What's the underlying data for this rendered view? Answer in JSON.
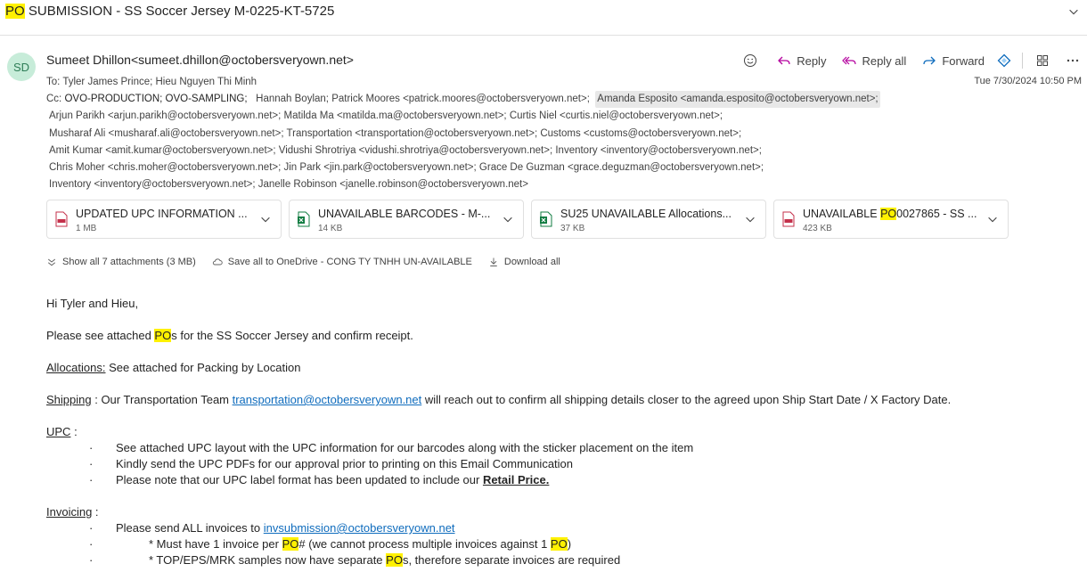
{
  "subject": {
    "hl": "PO",
    "rest": " SUBMISSION - SS Soccer Jersey M-0225-KT-5725"
  },
  "sender": {
    "initials": "SD",
    "name": "Sumeet Dhillon",
    "email": "<sumeet.dhillon@octobersveryown.net>"
  },
  "actions": {
    "reply": "Reply",
    "reply_all": "Reply all",
    "forward": "Forward"
  },
  "date": "Tue 7/30/2024 10:50 PM",
  "to_line": "To:  Tyler James Prince;   Hieu Nguyen Thi Minh",
  "cc": {
    "label": "Cc:",
    "first": "OVO-PRODUCTION;  OVO-SAMPLING;",
    "rest": "Hannah Boylan;   Patrick Moores <patrick.moores@octobersveryown.net>;",
    "chip": "Amanda Esposito <amanda.esposito@octobersveryown.net>;",
    "lines": [
      "Arjun Parikh <arjun.parikh@octobersveryown.net>;   Matilda Ma <matilda.ma@octobersveryown.net>;   Curtis Niel <curtis.niel@octobersveryown.net>;",
      "Musharaf Ali <musharaf.ali@octobersveryown.net>;   Transportation <transportation@octobersveryown.net>;   Customs <customs@octobersveryown.net>;",
      "Amit Kumar <amit.kumar@octobersveryown.net>;   Vidushi Shrotriya <vidushi.shrotriya@octobersveryown.net>;   Inventory <inventory@octobersveryown.net>;",
      "Chris Moher <chris.moher@octobersveryown.net>;   Jin Park <jin.park@octobersveryown.net>;   Grace De Guzman <grace.deguzman@octobersveryown.net>;",
      "Inventory <inventory@octobersveryown.net>;   Janelle Robinson <janelle.robinson@octobersveryown.net>"
    ]
  },
  "attachments": [
    {
      "name": "UPDATED UPC INFORMATION ...",
      "size": "1 MB",
      "type": "pdf"
    },
    {
      "name": "UNAVAILABLE BARCODES - M-...",
      "size": "14 KB",
      "type": "excel"
    },
    {
      "name": "SU25 UNAVAILABLE Allocations...",
      "size": "37 KB",
      "type": "excel"
    },
    {
      "name_pre": "UNAVAILABLE ",
      "name_hl": "PO",
      "name_post": "0027865 - SS ...",
      "size": "423 KB",
      "type": "pdf"
    }
  ],
  "att_tools": {
    "show_all": "Show all 7 attachments (3 MB)",
    "save_onedrive": "Save all to OneDrive - CONG TY TNHH UN-AVAILABLE",
    "download_all": "Download all"
  },
  "body": {
    "greeting": "Hi Tyler and Hieu,",
    "p1_pre": "Please see attached ",
    "p1_hl": "PO",
    "p1_post": "s for the SS Soccer Jersey and confirm receipt.",
    "alloc_label": "Allocations:",
    "alloc_text": " See attached for Packing by Location",
    "ship_label": "Shipping",
    "ship_pre": " : Our Transportation Team ",
    "ship_link": "transportation@octobersveryown.net",
    "ship_post": " will reach out to confirm all shipping details closer to the agreed upon Ship Start Date / X Factory Date.",
    "upc_label": "UPC",
    "upc_colon": " :",
    "bullet_char": "·",
    "upc_items": [
      "See attached UPC layout with the UPC information for our barcodes along with the sticker placement on the item",
      "Kindly send the UPC PDFs for our approval prior to printing on this Email Communication"
    ],
    "upc_item3_pre": "Please note that our UPC label format has been updated to include our ",
    "upc_item3_strong": "Retail Price.",
    "inv_label": "Invoicing",
    "inv_colon": " :",
    "inv_item1_pre": "Please send ALL invoices to ",
    "inv_item1_link": "invsubmission@octobersveryown.net",
    "inv_item2_a": "* Must have 1 invoice per ",
    "inv_item2_hl1": "PO",
    "inv_item2_b": "# (we cannot process multiple invoices against 1 ",
    "inv_item2_hl2": "PO",
    "inv_item2_c": ")",
    "inv_item3_a": "* TOP/EPS/MRK samples now have separate ",
    "inv_item3_hl": "PO",
    "inv_item3_b": "s, therefore separate invoices are required"
  },
  "colors": {
    "accent": "#0f6cbd",
    "highlight": "#fff100",
    "avatar_bg": "#c7ecd9"
  },
  "icons": [
    "chevron-down-icon",
    "emoji-icon",
    "reply-icon",
    "reply-all-icon",
    "forward-icon",
    "copilot-icon",
    "apps-icon",
    "more-icon",
    "pdf-icon",
    "excel-icon",
    "cloud-icon",
    "download-icon"
  ]
}
